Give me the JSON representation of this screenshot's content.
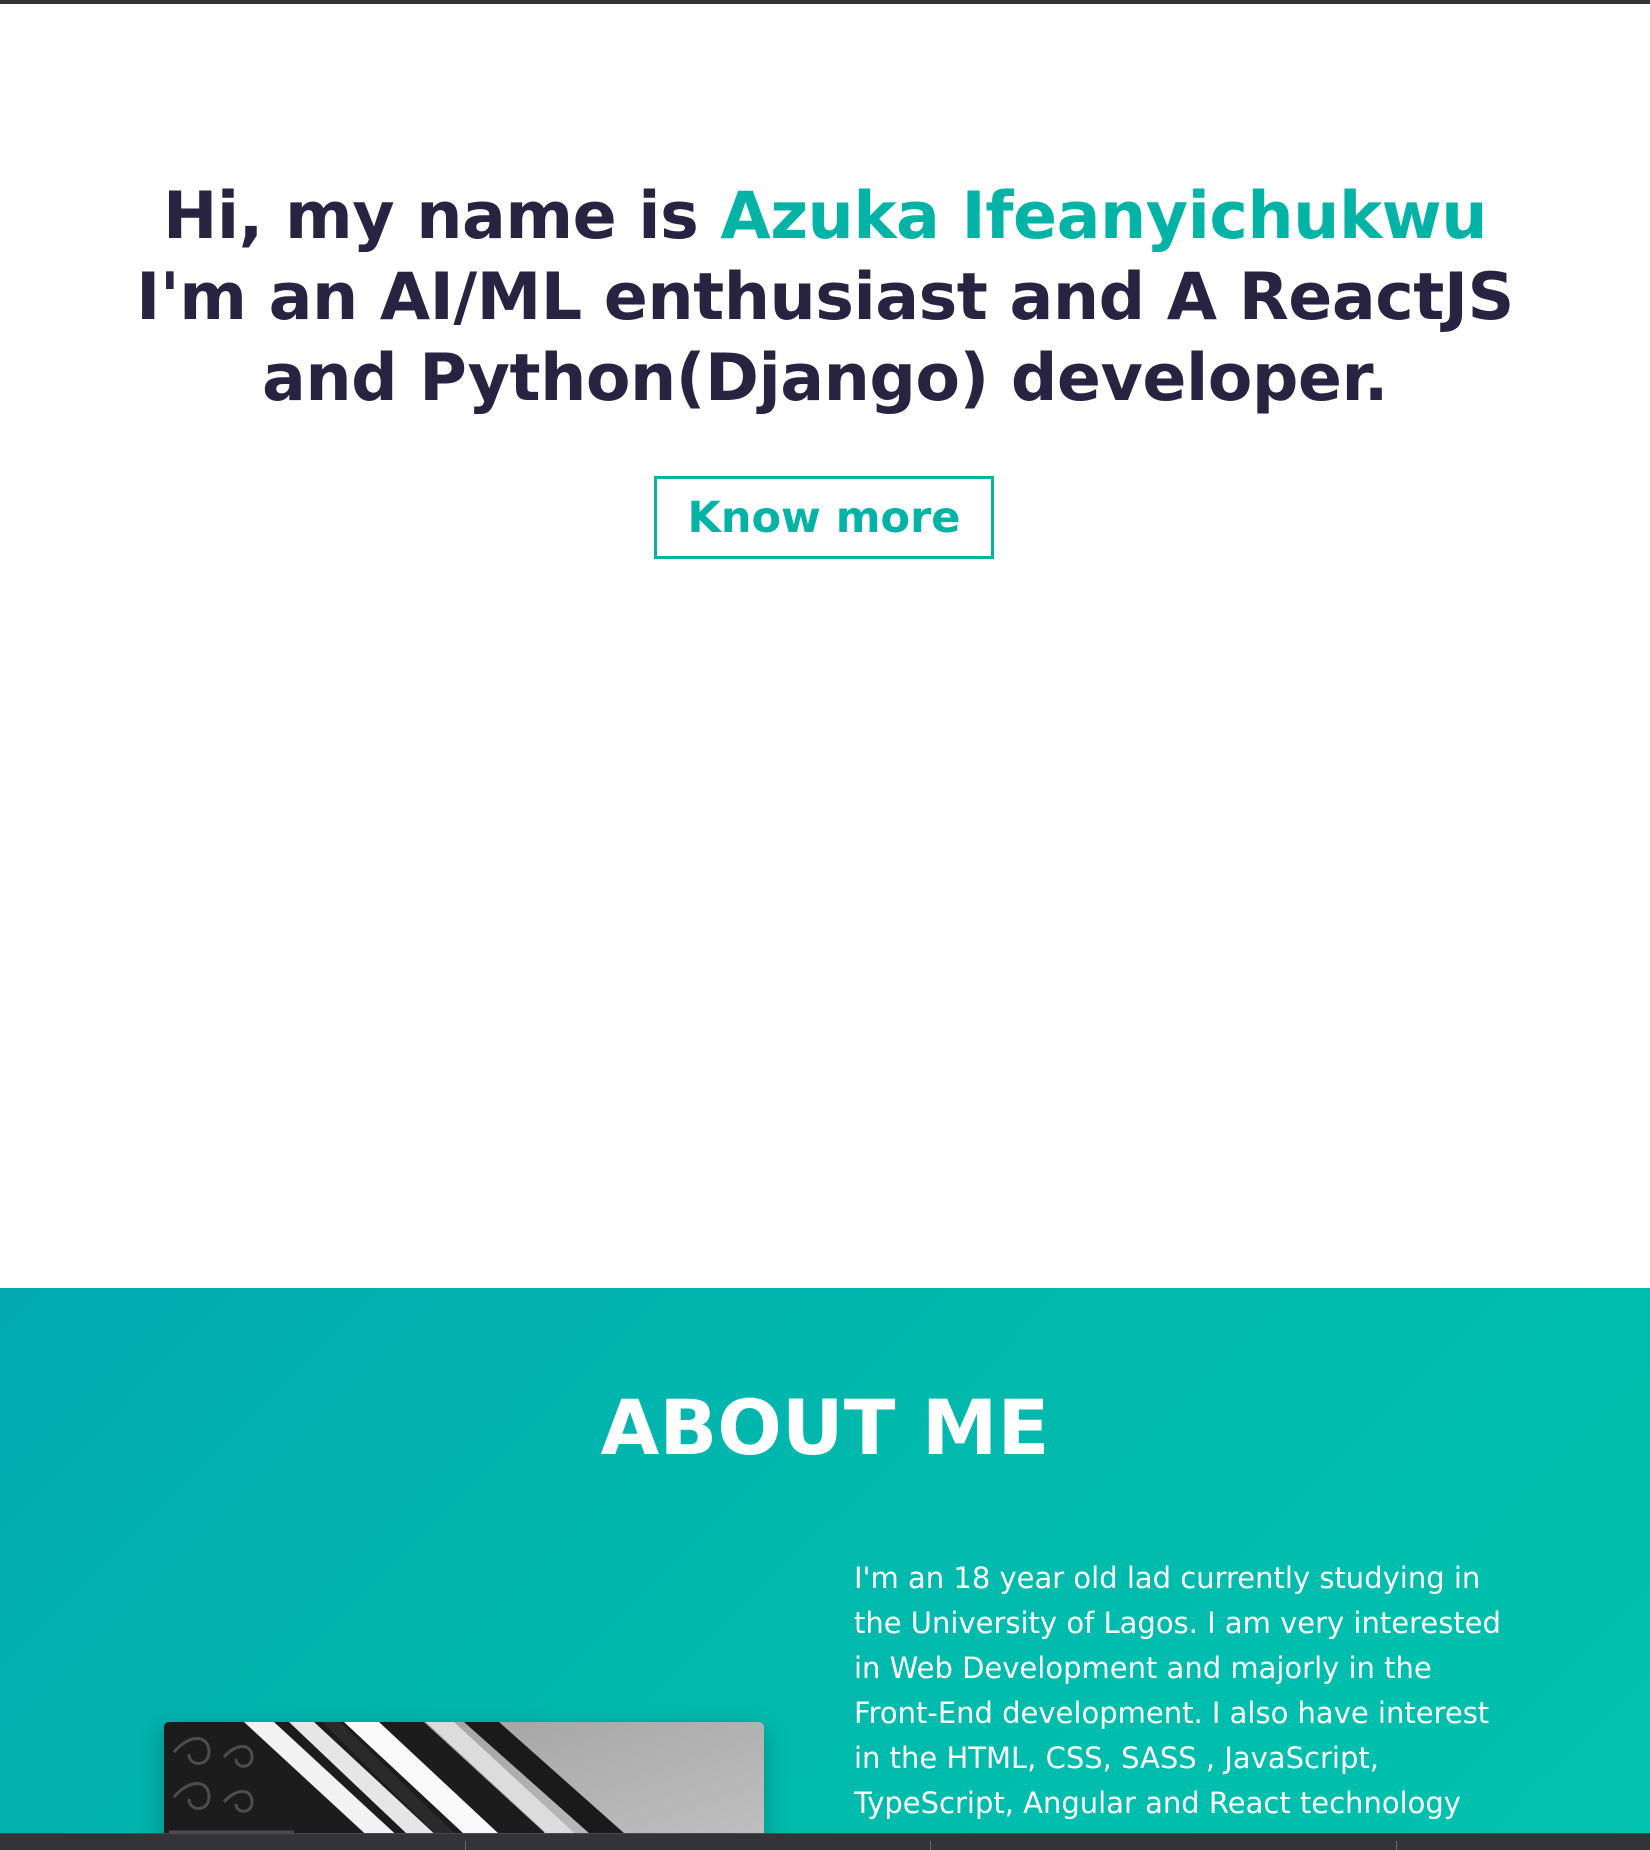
{
  "hero": {
    "greeting": "Hi, my name is ",
    "name": "Azuka Ifeanyichukwu",
    "tagline_line1": "I'm an AI/ML enthusiast and A ReactJS",
    "tagline_line2": "and Python(Django) developer.",
    "cta_label": "Know more"
  },
  "about": {
    "title": "ABOUT ME",
    "bio_lines": [
      "I'm an 18 year old lad currently studying in",
      "the University of Lagos. I am very interested",
      "in Web Development and majorly in the",
      "Front-End development. I also have interest",
      "in the HTML, CSS, SASS , JavaScript,",
      "TypeScript, Angular and React technology"
    ]
  },
  "colors": {
    "accent": "#02b3a6",
    "heading": "#272341",
    "about_bg_start": "#02aab0",
    "about_bg_end": "#00c3ad"
  }
}
